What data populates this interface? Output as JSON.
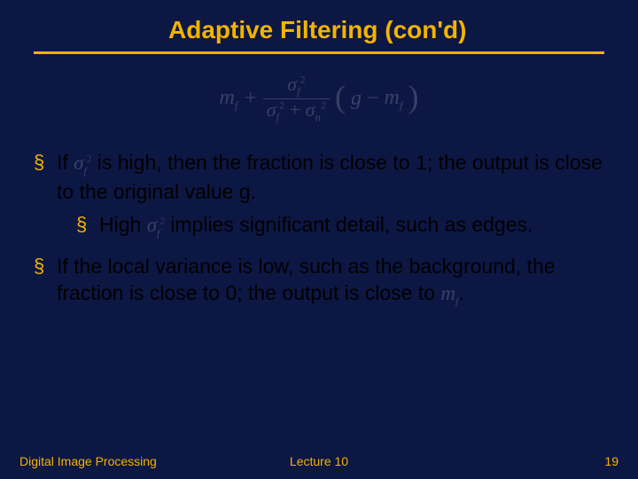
{
  "title": "Adaptive Filtering (con'd)",
  "formula": {
    "m_f": "m",
    "m_f_sub": "f",
    "plus": "+",
    "num_sigma": "σ",
    "num_sub": "f",
    "num_sup": "2",
    "den_sigma1": "σ",
    "den_sub1": "f",
    "den_sup1": "2",
    "den_plus": "+",
    "den_sigma2": "σ",
    "den_sub2": "n",
    "den_sup2": "2",
    "lparen": "(",
    "g": "g",
    "minus": "−",
    "m_f2": "m",
    "m_f2_sub": "f",
    "rparen": ")"
  },
  "bullets": [
    {
      "pre": "If ",
      "sym": {
        "s": "σ",
        "sub": "f",
        "sup": "2"
      },
      "post": " is high, then the fraction is close to 1; the output is close to the original value g.",
      "children": [
        {
          "pre": "High ",
          "sym": {
            "s": "σ",
            "sub": "f",
            "sup": "2"
          },
          "post": " implies significant detail, such as edges."
        }
      ]
    },
    {
      "pre": "If the local variance is low, such as the background, the fraction is close to 0; the output is close to ",
      "sym": {
        "s": "m",
        "sub": "f",
        "sup": ""
      },
      "post": "."
    }
  ],
  "footer": {
    "left": "Digital Image Processing",
    "center": "Lecture 10",
    "right": "19"
  }
}
